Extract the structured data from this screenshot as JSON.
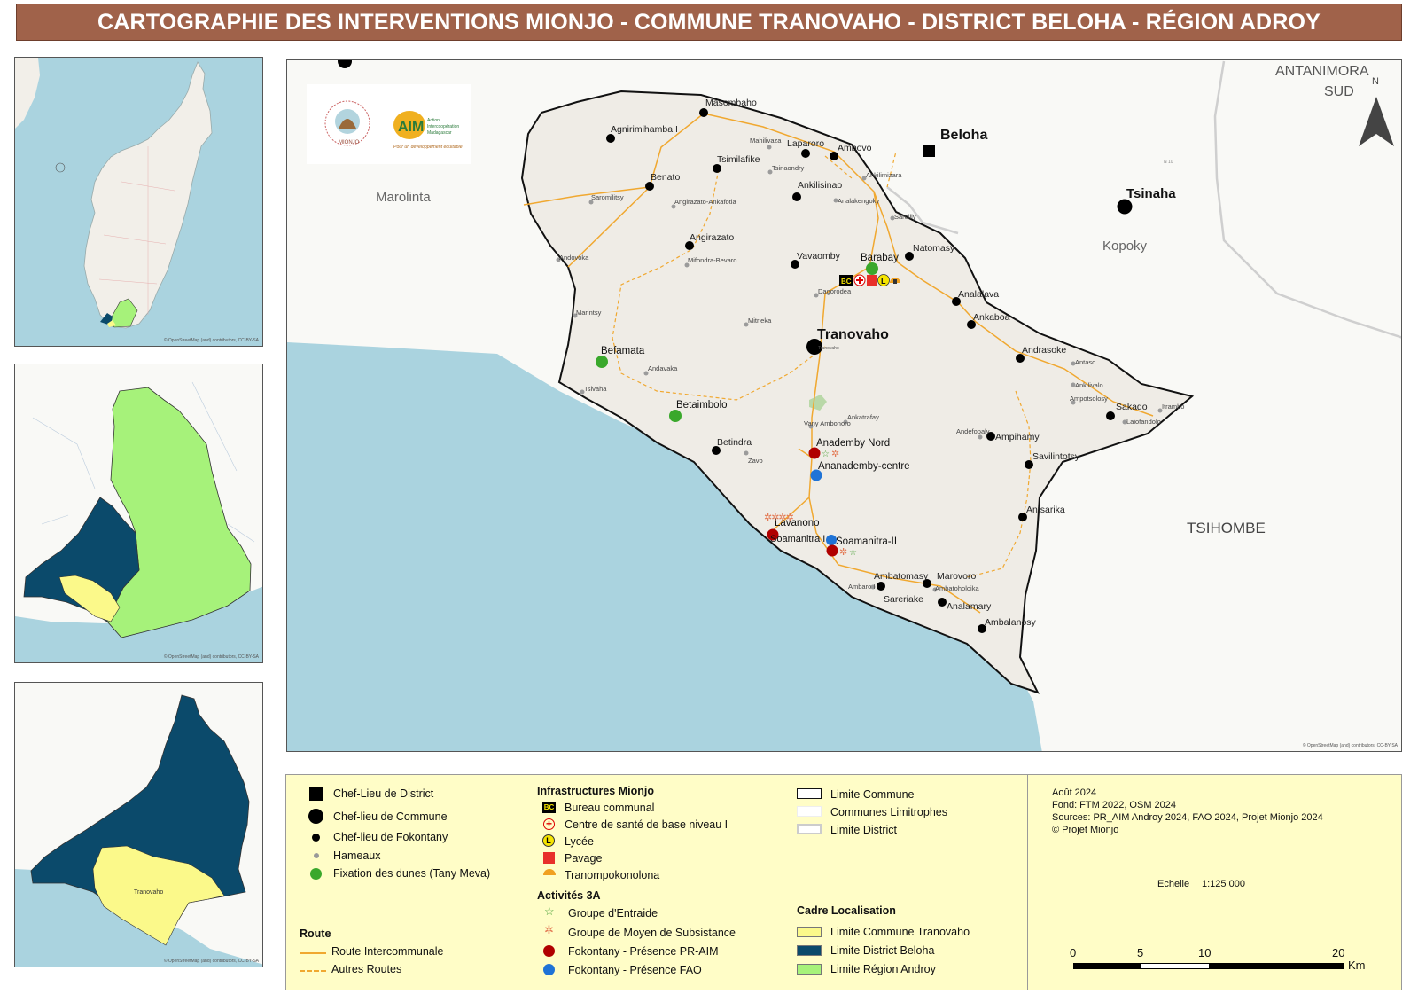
{
  "title": "CARTOGRAPHIE DES INTERVENTIONS MIONJO - COMMUNE TRANOVAHO - DISTRICT BELOHA - RÉGION ADROY",
  "colors": {
    "title_bar": "#a0624a",
    "sea": "#aad3df",
    "commune_fill": "#efece6",
    "outside_fill": "#f9f9f6",
    "route_intercommunale": "#f0a830",
    "region_androy": "#a6f27a",
    "district_beloha": "#0b4a6b",
    "commune_tranovaho": "#fbf98a",
    "legend_bg": "#fffdc7",
    "pr_aim": "#b00000",
    "fao": "#1f73d6",
    "dunes": "#3aa82c"
  },
  "logos": {
    "mionjo_text": "MIONJO",
    "aim_text": "AIM",
    "aim_sub1": "Action",
    "aim_sub2": "Intercoopération",
    "aim_sub3": "Madagascar",
    "aim_tagline": "Pour un développement équitable"
  },
  "map": {
    "outside_labels": {
      "marolinta": "Marolinta",
      "antanimora": "ANTANIMORA",
      "sud": "SUD",
      "beloha": "Beloha",
      "tsinaha": "Tsinaha",
      "kopoky": "Kopoky",
      "tsihombe": "TSIHOMBE"
    },
    "commune_label": "Tranovaho",
    "fokontany": {
      "masombaho": "Masombaho",
      "agnirimihamba": "Agnirimihamba I",
      "laparoro": "Laparoro",
      "ambovo": "Ambovo",
      "tsimilafike": "Tsimilafike",
      "benato": "Benato",
      "ankilisinao": "Ankilisinao",
      "angirazato": "Angirazato",
      "vavaomby": "Vavaomby",
      "natomasy": "Natomasy",
      "barabay": "Barabay",
      "analalava": "Analalava",
      "ankaboa": "Ankaboa",
      "andrasoke": "Andrasoke",
      "sakado": "Sakado",
      "befamata": "Befamata",
      "betaimbolo": "Betaimbolo",
      "betindra": "Betindra",
      "anademby_nord": "Anademby Nord",
      "ananademby_centre": "Ananademby-centre",
      "ampihamy": "Ampihamy",
      "savilintotsy": "Savilintotsy",
      "antsarika": "Antsarika",
      "lavanono": "Lavanono",
      "soamanitra_i": "Soamanitra I",
      "soamanitra_ii": "Soamanitra-II",
      "ambatomasy": "Ambatomasy",
      "marovoro": "Marovoro",
      "sareriake": "Sareriake",
      "analamary": "Analamary",
      "ambalanosy": "Ambalanosy"
    },
    "hameaux": {
      "mahilivaza": "Mahilivaza",
      "tsinaondry": "Tsinaondry",
      "ankilimizara": "Ankilimizara",
      "analakengoky": "Analakengoky",
      "sarolily": "Sarolily",
      "saromilitsy": "Saromilitsy",
      "angirazato_ankafotia": "Angirazato-Ankafotia",
      "andovoka": "Andovoka",
      "mifondra_bevaro": "Mifondra-Bevaro",
      "dagorodea": "Dagorodea",
      "marintsy": "Marintsy",
      "mitrieka": "Mitrieka",
      "andavaka": "Andavaka",
      "tsivaha": "Tsivaha",
      "ankatrafay": "Ankatrafay",
      "vany_ambonoro": "Vany Ambonoro",
      "zavo": "Zavo",
      "andefopaly": "Andefopaly",
      "antaso": "Antaso",
      "ankilivalo": "Ankilivalo",
      "ampotsolosy": "Ampotsolosy",
      "laiofandolo": "Laiofandolo",
      "itrambo": "Itrambo",
      "ambaro_i": "Ambaro I",
      "ambatoholoika": "Ambatoholoika",
      "tranovaho_hameau": "Tranovaho"
    },
    "route_tag": "N 10",
    "credit": "© OpenStreetMap (and) contributors, CC-BY-SA"
  },
  "insets": {
    "madagascar_credit": "© OpenStreetMap (and) contributors, CC-BY-SA",
    "district_credit": "© OpenStreetMap (and) contributors, CC-BY-SA",
    "commune_label": "Tranovaho",
    "commune_credit": "© OpenStreetMap (and) contributors, CC-BY-SA"
  },
  "legend": {
    "symbols": [
      "Chef-Lieu de District",
      "Chef-lieu de Commune",
      "Chef-lieu de Fokontany",
      "Hameaux",
      "Fixation des dunes (Tany Meva)"
    ],
    "infra_title": "Infrastructures Mionjo",
    "infrastructures": [
      "Bureau communal",
      "Centre de santé de base niveau I",
      "Lycée",
      "Pavage",
      "Tranompokonolona"
    ],
    "bc_glyph": "BC",
    "lycee_glyph": "L",
    "activites_title": "Activités 3A",
    "activites": [
      "Groupe d'Entraide",
      "Groupe de Moyen de Subsistance",
      "Fokontany - Présence PR-AIM",
      "Fokontany - Présence FAO"
    ],
    "route_title": "Route",
    "routes": [
      "Route Intercommunale",
      "Autres Routes"
    ],
    "limites": [
      "Limite Commune",
      "Communes Limitrophes",
      "Limite District"
    ],
    "cadre_title": "Cadre Localisation",
    "cadre": [
      "Limite Commune Tranovaho",
      "Limite District Beloha",
      "Limite Région Androy"
    ],
    "info": [
      "Août 2024",
      "Fond: FTM 2022, OSM 2024",
      "Sources: PR_AIM Androy 2024, FAO 2024, Projet Mionjo 2024",
      "© Projet Mionjo"
    ],
    "scale_label": "Echelle",
    "scale_value": "1:125 000",
    "scale_ticks": [
      "0",
      "5",
      "10",
      "20"
    ],
    "scale_unit": "Km"
  }
}
